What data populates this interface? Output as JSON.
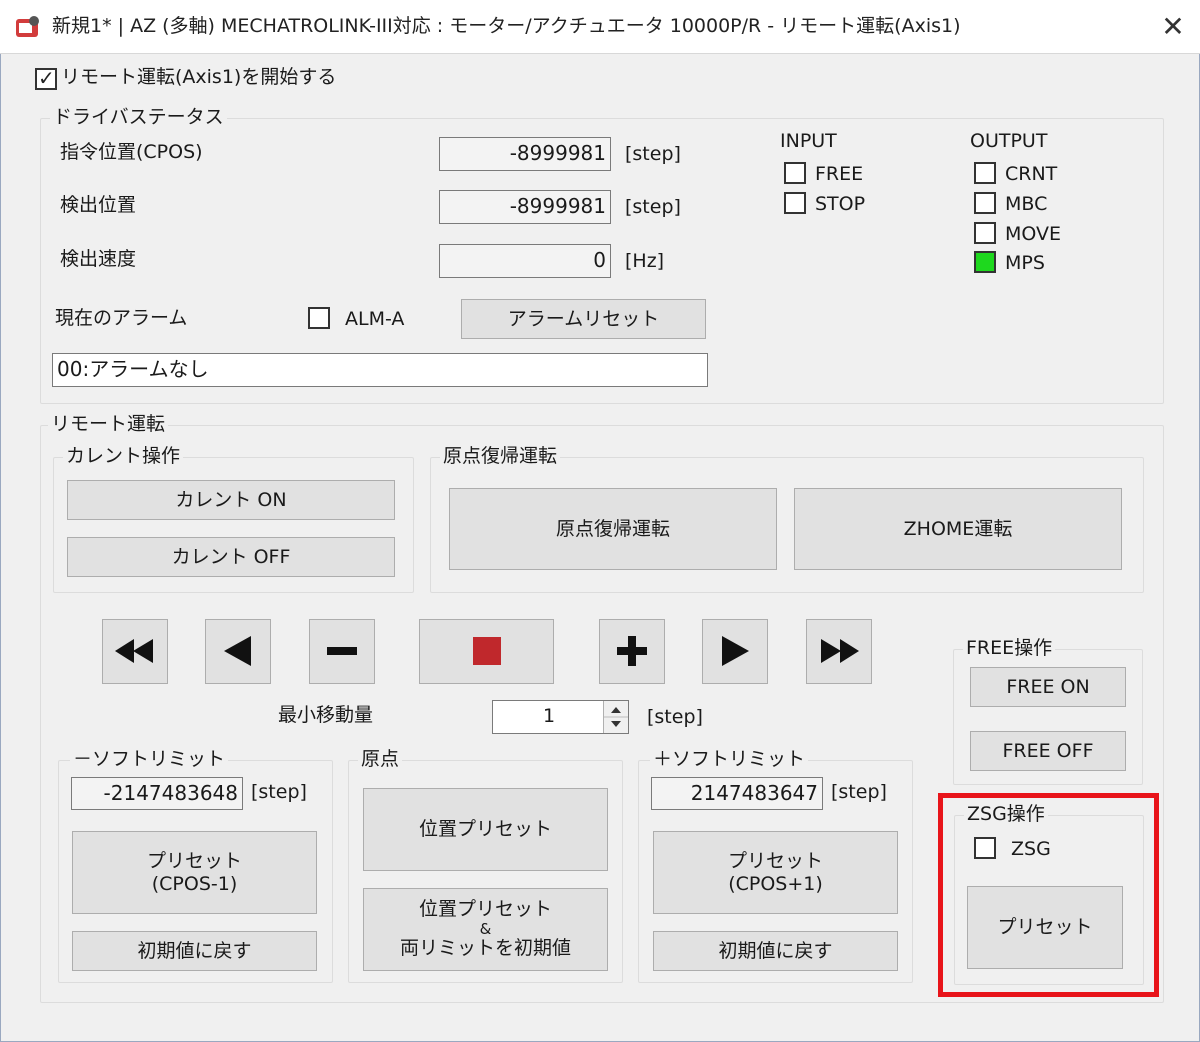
{
  "window": {
    "title": "新規1* | AZ (多軸) MECHATROLINK-III対応 : モーター/アクチュエータ 10000P/R - リモート運転(Axis1)",
    "close_icon": "close-icon"
  },
  "remote_start": {
    "label": "リモート運転(Axis1)を開始する",
    "checked": true
  },
  "driver_status": {
    "title": "ドライバステータス",
    "rows": [
      {
        "label": "指令位置(CPOS)",
        "value": "-8999981",
        "unit": "[step]"
      },
      {
        "label": "検出位置",
        "value": "-8999981",
        "unit": "[step]"
      },
      {
        "label": "検出速度",
        "value": "0",
        "unit": "[Hz]"
      }
    ],
    "alarm_label": "現在のアラーム",
    "alm_a_label": "ALM-A",
    "alarm_reset_button": "アラームリセット",
    "alarm_text": "00:アラームなし",
    "input": {
      "title": "INPUT",
      "items": [
        {
          "label": "FREE",
          "on": false
        },
        {
          "label": "STOP",
          "on": false
        }
      ]
    },
    "output": {
      "title": "OUTPUT",
      "items": [
        {
          "label": "CRNT",
          "on": false
        },
        {
          "label": "MBC",
          "on": false
        },
        {
          "label": "MOVE",
          "on": false
        },
        {
          "label": "MPS",
          "on": true
        }
      ]
    },
    "indicator_on_color": "#1ed81e"
  },
  "remote_operation": {
    "title": "リモート運転",
    "current": {
      "title": "カレント操作",
      "on_button": "カレント ON",
      "off_button": "カレント OFF"
    },
    "homing": {
      "title": "原点復帰運転",
      "home_button": "原点復帰運転",
      "zhome_button": "ZHOME運転"
    },
    "min_move": {
      "label": "最小移動量",
      "value": "1",
      "unit": "[step]"
    },
    "neg_limit": {
      "title": "－ソフトリミット",
      "value": "-2147483648",
      "unit": "[step]",
      "preset_line1": "プリセット",
      "preset_line2": "(CPOS-1)",
      "reset_button": "初期値に戻す"
    },
    "origin": {
      "title": "原点",
      "preset_button": "位置プリセット",
      "preset_both_line1": "位置プリセット",
      "preset_both_line2": "&",
      "preset_both_line3": "両リミットを初期値"
    },
    "pos_limit": {
      "title": "＋ソフトリミット",
      "value": "2147483647",
      "unit": "[step]",
      "preset_line1": "プリセット",
      "preset_line2": "(CPOS+1)",
      "reset_button": "初期値に戻す"
    },
    "free_ops": {
      "title": "FREE操作",
      "on_button": "FREE ON",
      "off_button": "FREE OFF"
    },
    "zsg_ops": {
      "title": "ZSG操作",
      "zsg_label": "ZSG",
      "preset_button": "プリセット"
    },
    "stop_color": "#c0282c",
    "highlight_color": "#e8141a"
  }
}
